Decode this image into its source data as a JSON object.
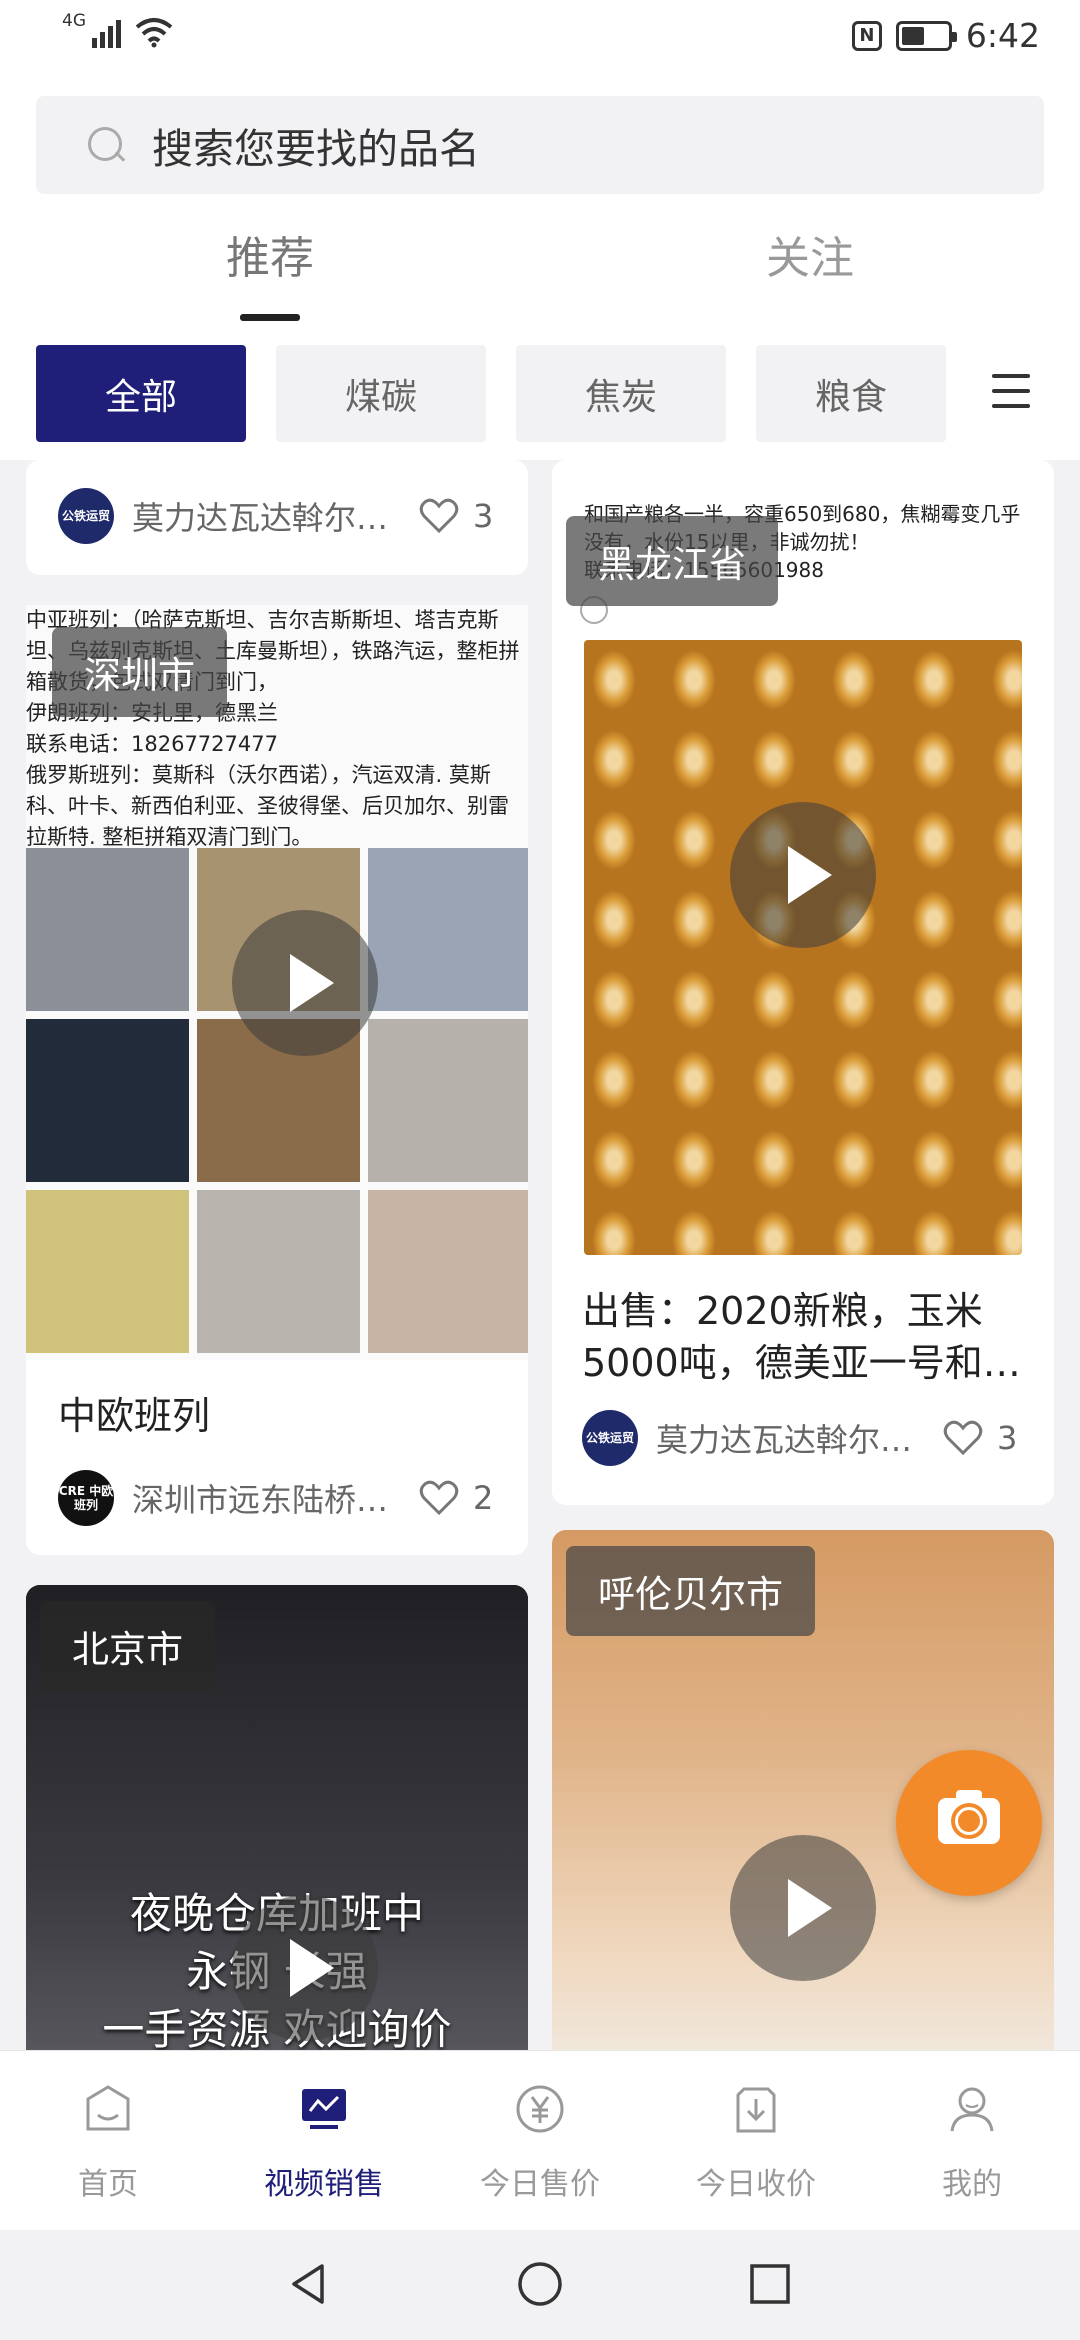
{
  "status_bar": {
    "network": "4G",
    "time": "6:42",
    "nfc": "N"
  },
  "search": {
    "placeholder": "搜索您要找的品名"
  },
  "tabs": [
    {
      "label": "推荐",
      "active": true
    },
    {
      "label": "关注",
      "active": false
    }
  ],
  "categories": [
    {
      "label": "全部",
      "active": true
    },
    {
      "label": "煤碳",
      "active": false
    },
    {
      "label": "焦炭",
      "active": false
    },
    {
      "label": "粮食",
      "active": false
    }
  ],
  "feed": {
    "left": [
      {
        "author": "莫力达瓦达斡尔…",
        "likes": "3",
        "avatar_text": "公铁运贸"
      },
      {
        "location": "深圳市",
        "description": "中亚班列：（哈萨克斯坦、吉尔吉斯斯坦、塔吉克斯坦、乌兹别克斯坦、土库曼斯坦），铁路汽运，整柜拼箱散货，包式双清门到门，\n伊朗班列：安扎里，德黑兰\n联系电话：18267727477\n俄罗斯班列：莫斯科（沃尔西诺），汽运双清. 莫斯科、叶卡、新西伯利亚、圣彼得堡、后贝加尔、别雷拉斯特. 整柜拼箱双清门到门。",
        "title": "中欧班列",
        "author": "深圳市远东陆桥…",
        "likes": "2",
        "avatar_text": "CRE 中欧班列"
      },
      {
        "location": "北京市",
        "overlay_text": "夜晚仓库加班中\n永钢 长强\n一手资源 欢迎询价"
      }
    ],
    "right": [
      {
        "location": "黑龙江省",
        "description": "和国产粮各一半，容重650到680，焦糊霉变几乎没有，水份15以里，非诚勿扰！\n联系电话：15565601988",
        "title": "出售：2020新粮，玉米5000吨，德美亚一号和…",
        "author": "莫力达瓦达斡尔…",
        "likes": "3",
        "avatar_text": "公铁运贸"
      },
      {
        "location": "呼伦贝尔市"
      }
    ]
  },
  "bottom_nav": [
    {
      "label": "首页",
      "icon": "home-icon",
      "active": false
    },
    {
      "label": "视频销售",
      "icon": "video-sales-icon",
      "active": true
    },
    {
      "label": "今日售价",
      "icon": "yen-price-icon",
      "active": false
    },
    {
      "label": "今日收价",
      "icon": "download-price-icon",
      "active": false
    },
    {
      "label": "我的",
      "icon": "profile-icon",
      "active": false
    }
  ],
  "colors": {
    "accent": "#1f1f7a",
    "fab": "#f28a2a",
    "background": "#f2f2f4"
  }
}
